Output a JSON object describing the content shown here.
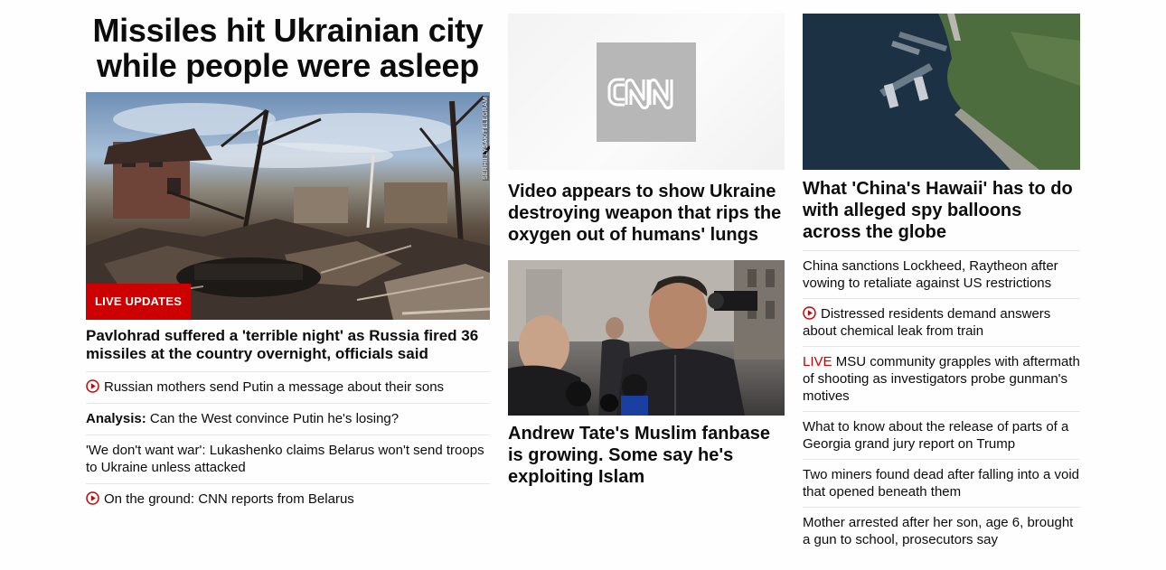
{
  "col1": {
    "headline": "Missiles hit Ukrainian city while people were asleep",
    "image_credit": "SERHII LYSAK/TELEGRAM",
    "live_badge": "LIVE UPDATES",
    "lead_title": "Pavlohrad suffered a 'terrible night' as Russia fired 36 missiles at the country overnight, officials said",
    "links": [
      {
        "prefix": "",
        "text": "Russian mothers send Putin a message about their sons",
        "video": true
      },
      {
        "prefix": "Analysis:",
        "text": " Can the West convince Putin he's losing?",
        "video": false
      },
      {
        "prefix": "",
        "text": "'We don't want war': Lukashenko claims Belarus won't send troops to Ukraine unless attacked",
        "video": false
      },
      {
        "prefix": "",
        "text": "On the ground: CNN reports from Belarus",
        "video": true
      }
    ]
  },
  "col2": {
    "cnn_logo": "CNN",
    "story1_title": "Video appears to show Ukraine destroying weapon that rips the oxygen out of humans' lungs",
    "story2_title": "Andrew Tate's Muslim fanbase is growing. Some say he's exploiting Islam"
  },
  "col3": {
    "main_title": "What 'China's Hawaii' has to do with alleged spy balloons across the globe",
    "links": [
      {
        "prefix": "",
        "text": "China sanctions Lockheed, Raytheon after vowing to retaliate against US restrictions",
        "video": false
      },
      {
        "prefix": "",
        "text": "Distressed residents demand answers about chemical leak from train",
        "video": true
      },
      {
        "prefix": "LIVE",
        "text": " MSU community grapples with aftermath of shooting as investigators probe gunman's motives",
        "video": false
      },
      {
        "prefix": "",
        "text": "What to know about the release of parts of a Georgia grand jury report on Trump",
        "video": false
      },
      {
        "prefix": "",
        "text": "Two miners found dead after falling into a void that opened beneath them",
        "video": false
      },
      {
        "prefix": "",
        "text": "Mother arrested after her son, age 6, brought a gun to school, prosecutors say",
        "video": false
      }
    ]
  },
  "colors": {
    "brand_red": "#cc0000",
    "divider": "#e6e6e6",
    "text": "#0c0c0c"
  },
  "icons": {
    "video": "play-circle-icon"
  }
}
